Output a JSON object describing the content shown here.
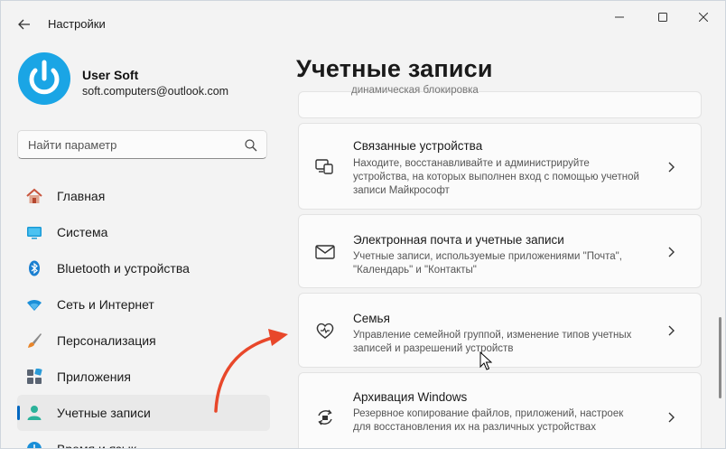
{
  "window": {
    "title": "Настройки",
    "controls": [
      "minimize",
      "maximize",
      "close"
    ]
  },
  "profile": {
    "name": "User Soft",
    "email": "soft.computers@outlook.com"
  },
  "search": {
    "placeholder": "Найти параметр"
  },
  "sidebar": {
    "items": [
      {
        "label": "Главная",
        "icon": "home-icon",
        "active": false
      },
      {
        "label": "Система",
        "icon": "system-icon",
        "active": false
      },
      {
        "label": "Bluetooth и устройства",
        "icon": "bluetooth-icon",
        "active": false
      },
      {
        "label": "Сеть и Интернет",
        "icon": "wifi-icon",
        "active": false
      },
      {
        "label": "Персонализация",
        "icon": "brush-icon",
        "active": false
      },
      {
        "label": "Приложения",
        "icon": "apps-icon",
        "active": false
      },
      {
        "label": "Учетные записи",
        "icon": "user-icon",
        "active": true
      },
      {
        "label": "Время и язык",
        "icon": "clock-icon",
        "active": false
      }
    ]
  },
  "main": {
    "title": "Учетные записи",
    "partial_card_text": "динамическая блокировка",
    "cards": [
      {
        "title": "Связанные устройства",
        "description": "Находите, восстанавливайте и администрируйте устройства, на которых выполнен вход с помощью учетной записи Майкрософт",
        "icon": "linked-devices-icon"
      },
      {
        "title": "Электронная почта и учетные записи",
        "description": "Учетные записи, используемые приложениями \"Почта\", \"Календарь\" и \"Контакты\"",
        "icon": "mail-icon"
      },
      {
        "title": "Семья",
        "description": "Управление семейной группой, изменение типов учетных записей и разрешений устройств",
        "icon": "family-icon"
      },
      {
        "title": "Архивация Windows",
        "description": "Резервное копирование файлов, приложений, настроек для восстановления их на различных устройствах",
        "icon": "backup-icon"
      }
    ]
  },
  "colors": {
    "accent": "#0067c0",
    "avatar": "#1aa5e5",
    "annotation_arrow": "#e8472a"
  }
}
